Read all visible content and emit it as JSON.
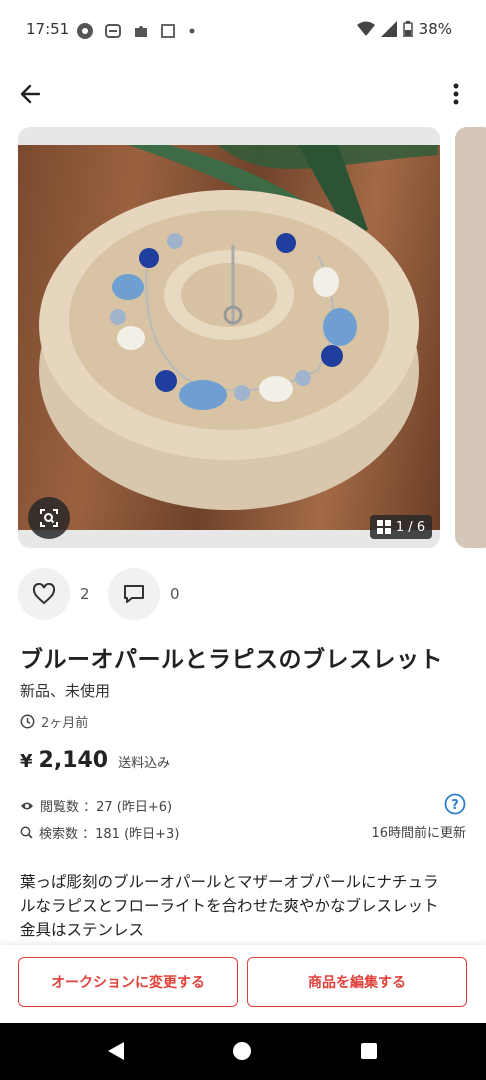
{
  "status_bar": {
    "time": "17:51",
    "battery": "38%",
    "icons": [
      "app-icon",
      "message-icon",
      "puzzle-icon",
      "square-icon",
      "dot-icon",
      "wifi-icon",
      "signal-icon",
      "battery-icon"
    ]
  },
  "top_bar": {
    "back_icon": "arrow-left-icon",
    "more_icon": "more-vertical-icon"
  },
  "gallery": {
    "counter": "1 / 6",
    "lens_icon": "image-search-icon"
  },
  "actions": {
    "likes_count": "2",
    "comments_count": "0"
  },
  "product": {
    "title": "ブルーオパールとラピスのブレスレット",
    "condition": "新品、未使用",
    "posted": "2ヶ月前",
    "price_symbol": "¥",
    "price": "2,140",
    "shipping_note": "送料込み",
    "views_label": "閲覧数 ：27 (昨日+6)",
    "searches_label": "検索数 ：181 (昨日+3)",
    "updated": "16時間前に更新",
    "description_line1": "葉っぱ彫刻のブルーオパールとマザーオブパールにナチュラ",
    "description_line2": "ルなラピスとフローライトを合わせた爽やかなブレスレット",
    "description_line3": "金具はステンレス"
  },
  "bottom_buttons": {
    "auction_label": "オークションに変更する",
    "edit_label": "商品を編集する"
  },
  "colors": {
    "accent": "#e0423b",
    "help": "#2f7fd1"
  }
}
